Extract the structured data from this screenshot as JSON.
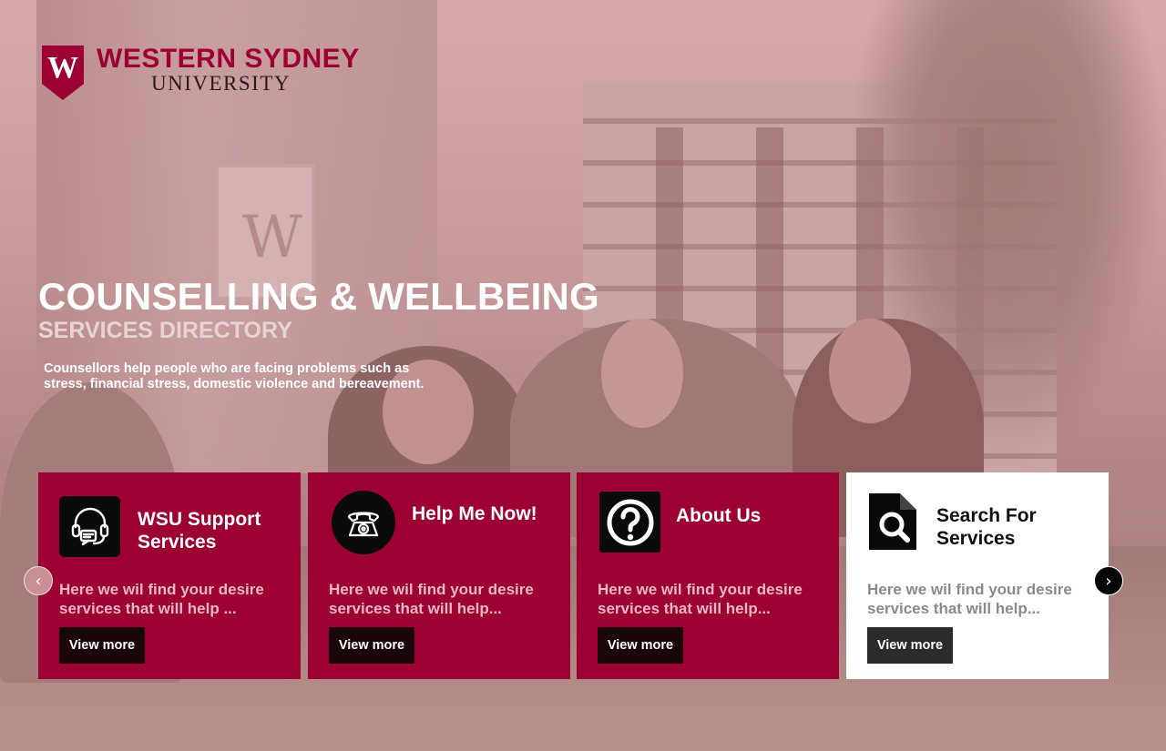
{
  "brand": {
    "logo_letter": "W",
    "name_main": "WESTERN SYDNEY",
    "name_sub": "UNIVERSITY",
    "color": "#9d0033"
  },
  "hero": {
    "title": "COUNSELLING & WELLBEING",
    "subtitle": "SERVICES DIRECTORY",
    "lead": "Counsellors help people who are facing problems such as stress, financial stress, domestic violence and bereavement.",
    "banner_letter": "W"
  },
  "cards": [
    {
      "title": "WSU Support Services",
      "icon": "headset-chat-icon",
      "description": "Here we  wil  find your desire services that will help ...",
      "button_label": "View more"
    },
    {
      "title": "Help Me Now!",
      "icon": "telephone-icon",
      "description": "Here we  wil  find your desire services that will help...",
      "button_label": "View more"
    },
    {
      "title": "About Us",
      "icon": "question-mark-icon",
      "description": "Here we  wil  find your desire services that will help...",
      "button_label": "View more"
    },
    {
      "title": "Search For Services",
      "icon": "document-search-icon",
      "description": "Here we  wil  find your desire services that will help...",
      "button_label": "View more"
    }
  ],
  "carousel": {
    "prev_glyph": "‹",
    "next_glyph": "›"
  }
}
